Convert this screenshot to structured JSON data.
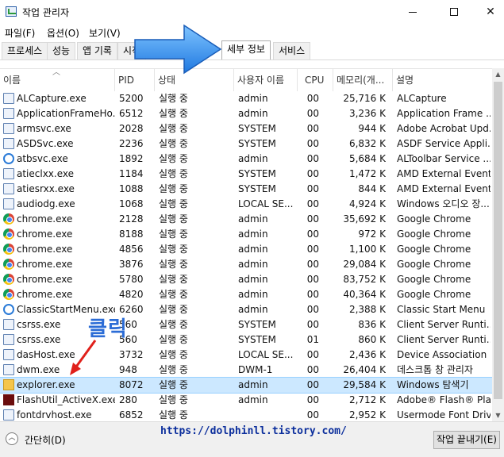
{
  "window": {
    "title": "작업 관리자"
  },
  "menu": [
    "파일(F)",
    "옵션(O)",
    "보기(V)"
  ],
  "tabs": [
    {
      "label": "프로세스"
    },
    {
      "label": "성능"
    },
    {
      "label": "앱 기록"
    },
    {
      "label": "시작"
    },
    {
      "label": "세부 정보",
      "active": true
    },
    {
      "label": "서비스"
    }
  ],
  "columns": [
    "이름",
    "PID",
    "상태",
    "사용자 이름",
    "CPU",
    "메모리(개...",
    "설명"
  ],
  "rows": [
    {
      "icon": "app-window-icon",
      "name": "ALCapture.exe",
      "pid": "5200",
      "status": "실행 중",
      "user": "admin",
      "cpu": "00",
      "mem": "25,716 K",
      "desc": "ALCapture"
    },
    {
      "icon": "app-window-icon",
      "name": "ApplicationFrameHo...",
      "pid": "6512",
      "status": "실행 중",
      "user": "admin",
      "cpu": "00",
      "mem": "3,236 K",
      "desc": "Application Frame ..."
    },
    {
      "icon": "app-window-icon",
      "name": "armsvc.exe",
      "pid": "2028",
      "status": "실행 중",
      "user": "SYSTEM",
      "cpu": "00",
      "mem": "944 K",
      "desc": "Adobe Acrobat Upd..."
    },
    {
      "icon": "app-window-icon",
      "name": "ASDSvc.exe",
      "pid": "2236",
      "status": "실행 중",
      "user": "SYSTEM",
      "cpu": "00",
      "mem": "6,832 K",
      "desc": "ASDF Service Appli..."
    },
    {
      "icon": "circle-app-icon",
      "name": "atbsvc.exe",
      "pid": "1892",
      "status": "실행 중",
      "user": "admin",
      "cpu": "00",
      "mem": "5,684 K",
      "desc": "ALToolbar Service ..."
    },
    {
      "icon": "app-window-icon",
      "name": "atieclxx.exe",
      "pid": "1184",
      "status": "실행 중",
      "user": "SYSTEM",
      "cpu": "00",
      "mem": "1,472 K",
      "desc": "AMD External Event..."
    },
    {
      "icon": "app-window-icon",
      "name": "atiesrxx.exe",
      "pid": "1088",
      "status": "실행 중",
      "user": "SYSTEM",
      "cpu": "00",
      "mem": "844 K",
      "desc": "AMD External Event..."
    },
    {
      "icon": "app-window-icon",
      "name": "audiodg.exe",
      "pid": "1068",
      "status": "실행 중",
      "user": "LOCAL SE...",
      "cpu": "00",
      "mem": "4,924 K",
      "desc": "Windows 오디오 장..."
    },
    {
      "icon": "chrome-icon",
      "name": "chrome.exe",
      "pid": "2128",
      "status": "실행 중",
      "user": "admin",
      "cpu": "00",
      "mem": "35,692 K",
      "desc": "Google Chrome"
    },
    {
      "icon": "chrome-icon",
      "name": "chrome.exe",
      "pid": "8188",
      "status": "실행 중",
      "user": "admin",
      "cpu": "00",
      "mem": "972 K",
      "desc": "Google Chrome"
    },
    {
      "icon": "chrome-icon",
      "name": "chrome.exe",
      "pid": "4856",
      "status": "실행 중",
      "user": "admin",
      "cpu": "00",
      "mem": "1,100 K",
      "desc": "Google Chrome"
    },
    {
      "icon": "chrome-icon",
      "name": "chrome.exe",
      "pid": "3876",
      "status": "실행 중",
      "user": "admin",
      "cpu": "00",
      "mem": "29,084 K",
      "desc": "Google Chrome"
    },
    {
      "icon": "chrome-icon",
      "name": "chrome.exe",
      "pid": "5780",
      "status": "실행 중",
      "user": "admin",
      "cpu": "00",
      "mem": "83,752 K",
      "desc": "Google Chrome"
    },
    {
      "icon": "chrome-icon",
      "name": "chrome.exe",
      "pid": "4820",
      "status": "실행 중",
      "user": "admin",
      "cpu": "00",
      "mem": "40,364 K",
      "desc": "Google Chrome"
    },
    {
      "icon": "circle-app-icon",
      "name": "ClassicStartMenu.exe",
      "pid": "6260",
      "status": "실행 중",
      "user": "admin",
      "cpu": "00",
      "mem": "2,388 K",
      "desc": "Classic Start Menu"
    },
    {
      "icon": "app-window-icon",
      "name": "csrss.exe",
      "pid": "560",
      "status": "실행 중",
      "user": "SYSTEM",
      "cpu": "00",
      "mem": "836 K",
      "desc": "Client Server Runti..."
    },
    {
      "icon": "app-window-icon",
      "name": "csrss.exe",
      "pid": "560",
      "status": "실행 중",
      "user": "SYSTEM",
      "cpu": "01",
      "mem": "860 K",
      "desc": "Client Server Runti..."
    },
    {
      "icon": "app-window-icon",
      "name": "dasHost.exe",
      "pid": "3732",
      "status": "실행 중",
      "user": "LOCAL SE...",
      "cpu": "00",
      "mem": "2,436 K",
      "desc": "Device Association ..."
    },
    {
      "icon": "app-window-icon",
      "name": "dwm.exe",
      "pid": "948",
      "status": "실행 중",
      "user": "DWM-1",
      "cpu": "00",
      "mem": "26,404 K",
      "desc": "데스크톱 창 관리자"
    },
    {
      "icon": "folder-icon",
      "name": "explorer.exe",
      "pid": "8072",
      "status": "실행 중",
      "user": "admin",
      "cpu": "00",
      "mem": "29,584 K",
      "desc": "Windows 탐색기",
      "selected": true
    },
    {
      "icon": "flash-icon",
      "name": "FlashUtil_ActiveX.exe",
      "pid": "280",
      "status": "실행 중",
      "user": "admin",
      "cpu": "00",
      "mem": "2,712 K",
      "desc": "Adobe® Flash® Pla..."
    },
    {
      "icon": "app-window-icon",
      "name": "fontdrvhost.exe",
      "pid": "6852",
      "status": "실행 중",
      "user": "",
      "cpu": "00",
      "mem": "2,952 K",
      "desc": "Usermode Font Driv..."
    }
  ],
  "footer": {
    "collapse_label": "간단히(D)",
    "end_task_label": "작업 끝내기(E)"
  },
  "annotations": {
    "click_text": "클릭",
    "url": "https://dolphinll.tistory.com/"
  },
  "colors": {
    "selected_row": "#cce8ff",
    "annotation_blue": "#2b6cd6",
    "annotation_red": "#e0201b"
  }
}
